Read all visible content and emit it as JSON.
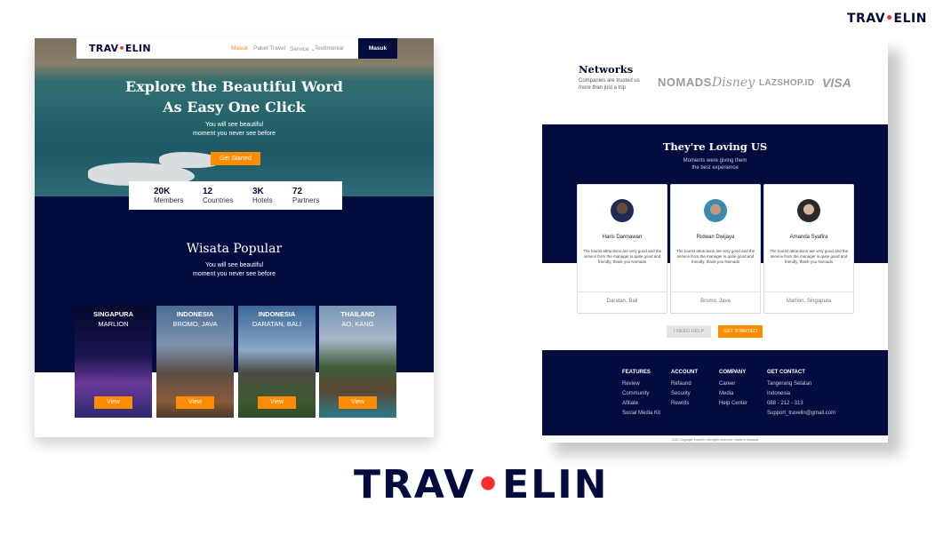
{
  "brand": {
    "logo_text_pre": "TRAV",
    "logo_mark": "•",
    "logo_text_post": "ELIN",
    "logo_full": "TRAVELIN"
  },
  "colors": {
    "navy": "#040b3f",
    "accent": "#ff8c00",
    "logo_dot": "#ff2a2a"
  },
  "left": {
    "nav": {
      "logo": "TRAVELIN",
      "masuk": "Masuk",
      "paket": "Paket Travel",
      "service": "Service ⌄",
      "testimonial": "Testimonial",
      "button": "Masuk"
    },
    "hero": {
      "title_line1": "Explore the  Beautiful Word",
      "title_line2": "As Easy One Click",
      "sub_line1": "You will see beautiful",
      "sub_line2": "moment you never see before",
      "cta": "Get Started"
    },
    "stats": [
      {
        "num": "20K",
        "label": "Members"
      },
      {
        "num": "12",
        "label": "Countries"
      },
      {
        "num": "3K",
        "label": "Hotels"
      },
      {
        "num": "72",
        "label": "Partners"
      }
    ],
    "popular": {
      "title": "Wisata Popular",
      "sub_line1": "You will see beautiful",
      "sub_line2": "moment you never see before"
    },
    "cards": [
      {
        "country": "SINGAPURA",
        "city": "MARLION",
        "button": "View"
      },
      {
        "country": "INDONESIA",
        "city": "BROMO, JAVA",
        "button": "View"
      },
      {
        "country": "INDONESIA",
        "city": "DARATAN, BALI",
        "button": "View"
      },
      {
        "country": "THAILAND",
        "city": "AO, KANG",
        "button": "View"
      }
    ]
  },
  "right": {
    "networks": {
      "title": "Networks",
      "sub": "Companies are trusted us more than just a trip",
      "brands": [
        "NOMADS",
        "Disney",
        "LAZSHOP.ID",
        "VISA"
      ]
    },
    "loving": {
      "title": "They're Loving US",
      "sub_line1": "Moments were giving them",
      "sub_line2": "the best experience"
    },
    "testimonials": [
      {
        "name": "Haris Darmawan",
        "quote": "The tourist attractions are very good and the service from the manager is quite good and friendly, thank you Nomads",
        "location": "Daratan, Bali"
      },
      {
        "name": "Ridwan Dwijaya",
        "quote": "The tourist attractions are very good and the service from the manager is quite good and friendly, thank you Nomads",
        "location": "Bromo, Java"
      },
      {
        "name": "Amanda Syafira",
        "quote": "The tourist attractions are very good and the service from the manager is quite good and friendly, thank you Nomads",
        "location": "Marlion, Singapura"
      }
    ],
    "buttons": {
      "need_help": "I NEED HELP",
      "get_started": "GET STARTED"
    },
    "footer": {
      "features": {
        "head": "FEATURES",
        "items": [
          "Review",
          "Community",
          "Afiliate",
          "Social Media Kit"
        ]
      },
      "account": {
        "head": "ACCOUNT",
        "items": [
          "Refaund",
          "Security",
          "Rewrds"
        ]
      },
      "company": {
        "head": "COMPANY",
        "items": [
          "Career",
          "Media",
          "Help Center"
        ]
      },
      "contact": {
        "head": "GET CONTACT",
        "items": [
          "Tangerang Selatan",
          "Indonesia",
          "088 - 212 - 313",
          "Support_travelin@gmail.com"
        ]
      },
      "copyright": "2020 Copyright Travelin • All rights reserved • Made in Nomads"
    }
  }
}
